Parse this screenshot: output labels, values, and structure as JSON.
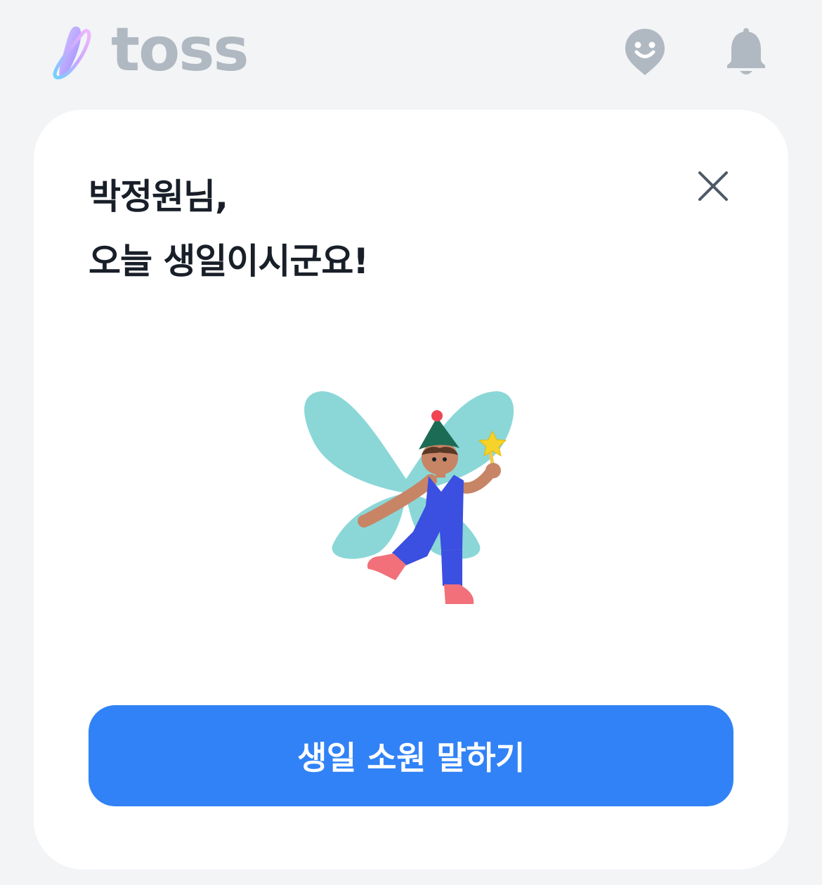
{
  "header": {
    "logo_text": "toss",
    "icons": {
      "face": "face-pin-icon",
      "bell": "bell-icon"
    }
  },
  "card": {
    "title_line1": "박정원님,",
    "title_line2": "오늘 생일이시군요!",
    "close_icon": "close-icon",
    "illustration": "birthday-fairy-illustration",
    "cta_label": "생일 소원 말하기"
  },
  "colors": {
    "background": "#f2f4f6",
    "card": "#ffffff",
    "title": "#191f28",
    "icon_gray": "#b0b8c1",
    "accent_blue": "#3182f6"
  }
}
